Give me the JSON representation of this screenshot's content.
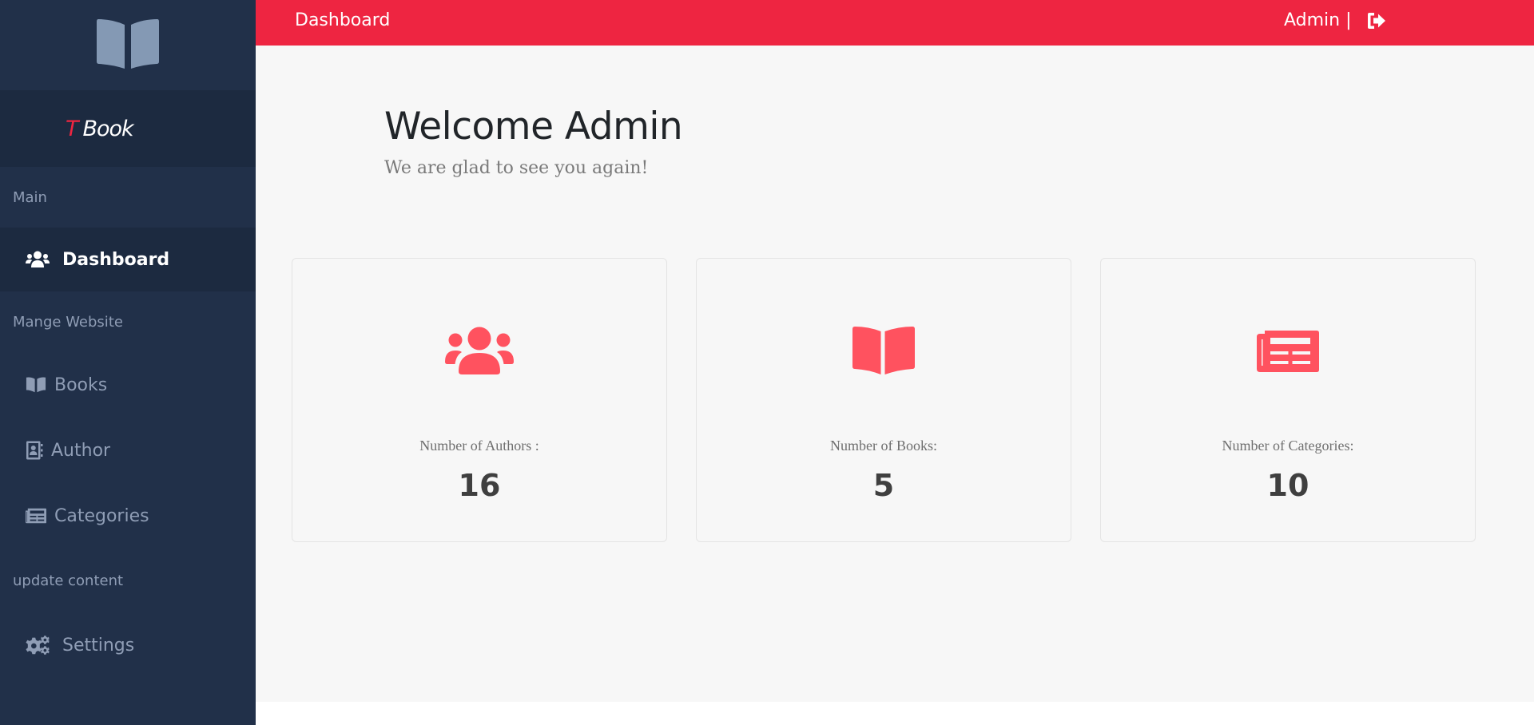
{
  "colors": {
    "accent": "#ee2541",
    "icon_red": "#ff525f",
    "sidebar_bg": "#213049",
    "sidebar_dark": "#1c2a40",
    "sidebar_text": "#8f9db5",
    "main_bg": "#f7f7f7"
  },
  "sidebar": {
    "logo_icon": "book-open-icon",
    "brand_prefix": "T",
    "brand_name": "Book",
    "sections": [
      {
        "label": "Main"
      },
      {
        "label": "Mange Website"
      },
      {
        "label": "update content"
      }
    ],
    "items": [
      {
        "label": "Dashboard",
        "icon": "users-icon",
        "active": true
      },
      {
        "label": "Books",
        "icon": "book-open-icon",
        "active": false
      },
      {
        "label": "Author",
        "icon": "address-book-icon",
        "active": false
      },
      {
        "label": "Categories",
        "icon": "newspaper-icon",
        "active": false
      },
      {
        "label": "Settings",
        "icon": "cogs-icon",
        "active": false
      }
    ]
  },
  "topbar": {
    "title": "Dashboard",
    "user": "Admin |",
    "logout_icon": "sign-out-icon"
  },
  "main": {
    "welcome_title": "Welcome Admin",
    "welcome_subtitle": "We are glad to see you again!",
    "stats": [
      {
        "label": "Number of Authors :",
        "value": "16",
        "icon": "users-icon"
      },
      {
        "label": "Number of Books:",
        "value": "5",
        "icon": "book-open-icon"
      },
      {
        "label": "Number of Categories:",
        "value": "10",
        "icon": "newspaper-icon"
      }
    ]
  }
}
